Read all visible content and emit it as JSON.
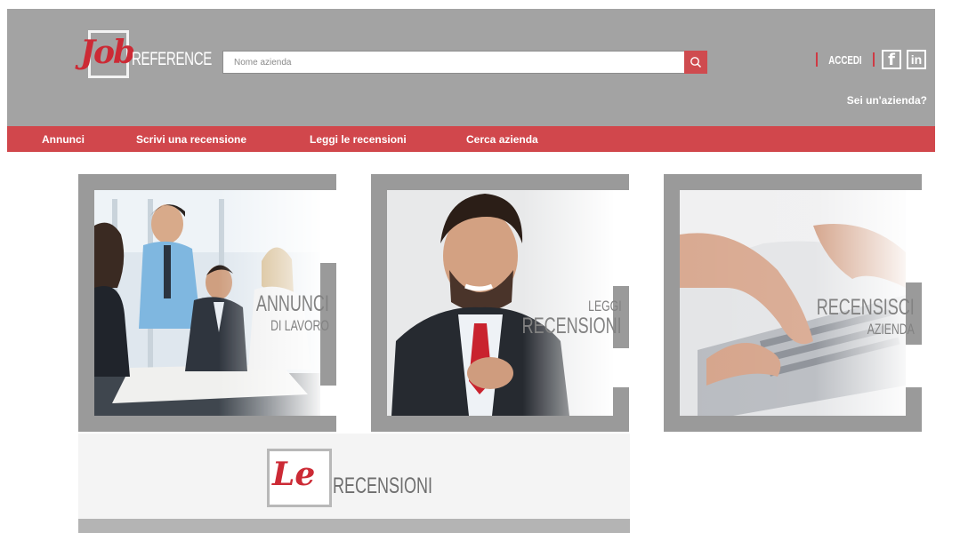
{
  "brand": {
    "script": "Job",
    "word": "REFERENCE"
  },
  "search": {
    "placeholder": "Nome azienda",
    "icon": "search-icon"
  },
  "account": {
    "login": "ACCEDI",
    "facebook": "f",
    "linkedin": "in",
    "company_link": "Sei un'azienda?"
  },
  "nav": {
    "items": [
      {
        "label": "Annunci"
      },
      {
        "label": "Scrivi una recensione"
      },
      {
        "label": "Leggi le recensioni"
      },
      {
        "label": "Cerca azienda"
      }
    ]
  },
  "cards": [
    {
      "line1": "ANNUNCI",
      "line2": "DI LAVORO"
    },
    {
      "line1": "LEGGI",
      "line2": "RECENSIONI"
    },
    {
      "line1": "RECENSISCI",
      "line2": "AZIENDA"
    }
  ],
  "reviews": {
    "script": "Le",
    "word": "RECENSIONI"
  },
  "colors": {
    "header_gray": "#a3a3a3",
    "accent_red": "#d1474c",
    "logo_red": "#cc2a35"
  }
}
